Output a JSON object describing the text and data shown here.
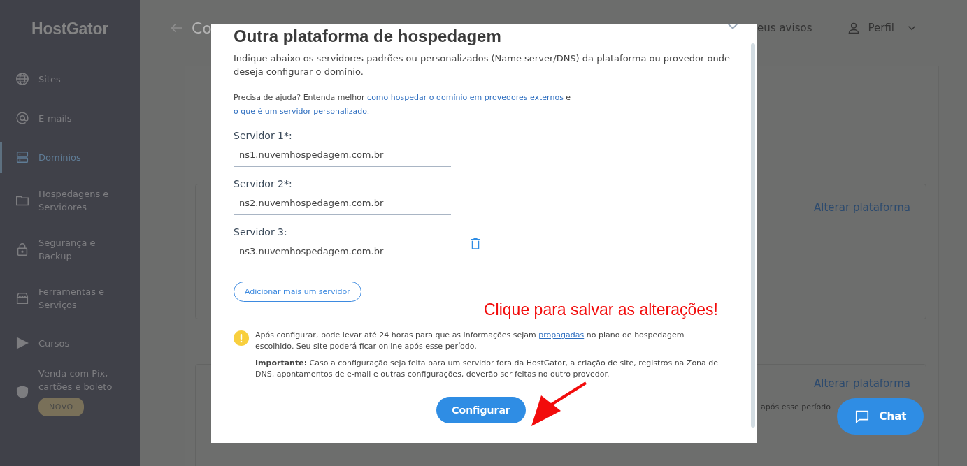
{
  "sidebar": {
    "logo": "HostGator",
    "items": [
      {
        "label": "Sites",
        "selected": false
      },
      {
        "label": "E-mails",
        "selected": false
      },
      {
        "label": "Domínios",
        "selected": true
      },
      {
        "label": "Hospedagens e Servidores",
        "selected": false
      },
      {
        "label": "Segurança e Backup",
        "selected": false
      },
      {
        "label": "Ferramentas e Serviços",
        "selected": false
      },
      {
        "label": "Cursos",
        "selected": false
      },
      {
        "label": "Venda com Pix, cartões e boleto",
        "selected": false,
        "badge": "NOVO"
      }
    ]
  },
  "header": {
    "title": "Co",
    "notices": "eus avisos",
    "profile": "Perfil"
  },
  "background_cards": [
    {
      "action": "Alterar plataforma"
    },
    {
      "action": "Alterar plataforma",
      "note": "após esse período"
    }
  ],
  "modal": {
    "title": "Outra plataforma de hospedagem",
    "description": "Indique abaixo os servidores padrões ou personalizados (Name server/DNS) da plataforma ou provedor onde deseja configurar o domínio.",
    "help": {
      "text": "Precisa de ajuda? Entenda melhor",
      "link_1": "como hospedar o domínio em provedores externos",
      "joiner": "e",
      "link_2": "o que é um servidor personalizado."
    },
    "servers": [
      {
        "label": "Servidor 1*:",
        "value": "ns1.nuvemhospedagem.com.br",
        "removable": false
      },
      {
        "label": "Servidor 2*:",
        "value": "ns2.nuvemhospedagem.com.br",
        "removable": false
      },
      {
        "label": "Servidor 3:",
        "value": "ns3.nuvemhospedagem.com.br",
        "removable": true
      }
    ],
    "add_button": "Adicionar mais um servidor",
    "notice": {
      "text_before": "Após configurar, pode levar até 24 horas para que as informações sejam",
      "link": "propagadas",
      "text_after": "no plano de hospedagem escolhido. Seu site poderá ficar online após esse período.",
      "important": "**Importante:** Caso a configuração seja feita para um servidor fora da HostGator, a criação de site, registros na Zona de DNS, apontamentos de e-mail e outras configurações, deverão ser feitas no outro provedor."
    },
    "submit": "Configurar"
  },
  "annotation": "Clique para salvar as alterações!",
  "chat": "Chat"
}
